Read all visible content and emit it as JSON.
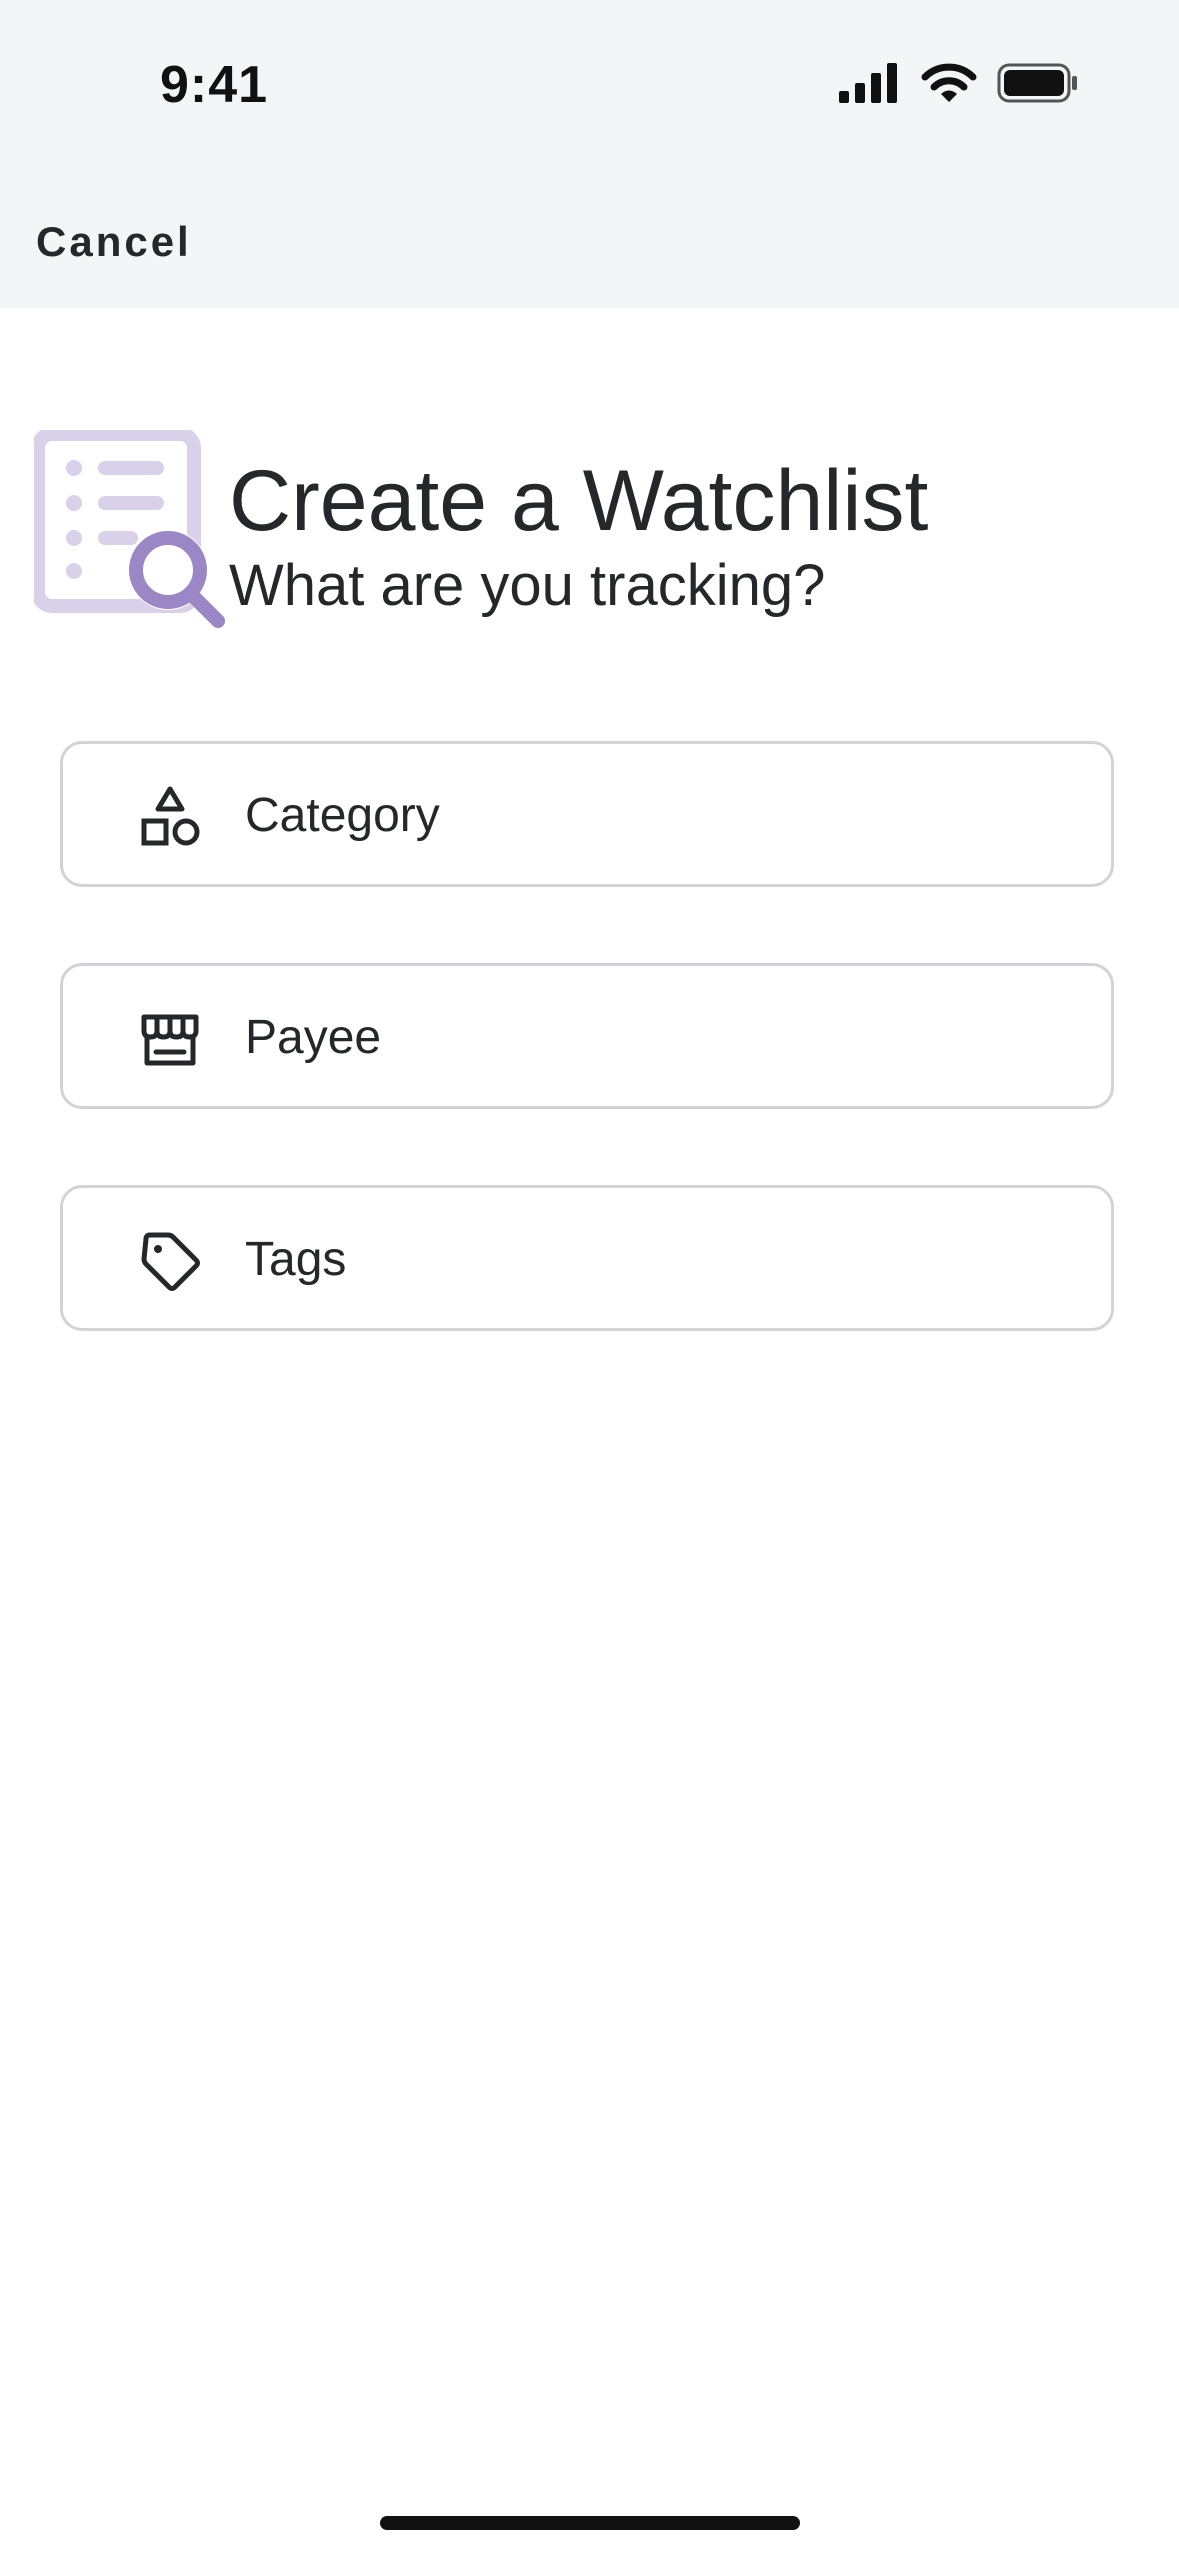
{
  "status_bar": {
    "time": "9:41"
  },
  "nav": {
    "cancel_label": "Cancel"
  },
  "hero": {
    "title": "Create a Watchlist",
    "subtitle": "What are you tracking?",
    "illustration": "watchlist-search-icon"
  },
  "options": [
    {
      "label": "Category",
      "icon": "shapes-icon"
    },
    {
      "label": "Payee",
      "icon": "storefront-icon"
    },
    {
      "label": "Tags",
      "icon": "tag-icon"
    }
  ],
  "colors": {
    "header_bg": "#f4f5f7",
    "accent_purple": "#9b86c6",
    "accent_purple_light": "#d9d0ea",
    "text": "#25272b",
    "border": "#d2d3d6"
  }
}
